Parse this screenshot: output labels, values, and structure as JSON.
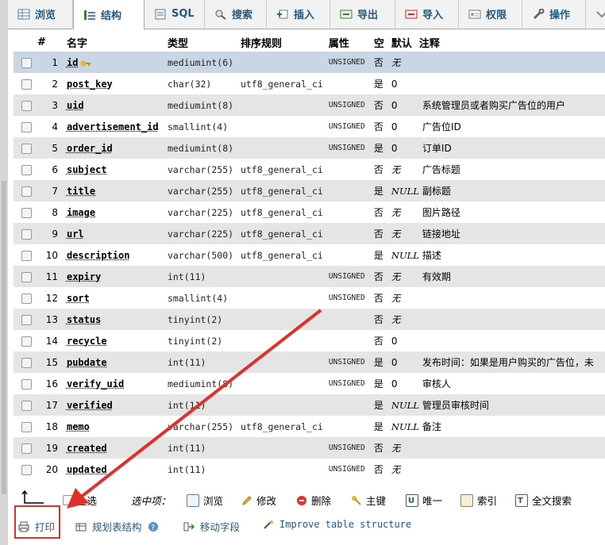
{
  "tabs": [
    {
      "label": "浏览",
      "icon": "browse-icon"
    },
    {
      "label": "结构",
      "icon": "structure-icon",
      "active": true
    },
    {
      "label": "SQL",
      "icon": "sql-icon"
    },
    {
      "label": "搜索",
      "icon": "search-icon"
    },
    {
      "label": "插入",
      "icon": "insert-icon"
    },
    {
      "label": "导出",
      "icon": "export-icon"
    },
    {
      "label": "导入",
      "icon": "import-icon"
    },
    {
      "label": "权限",
      "icon": "privileges-icon"
    },
    {
      "label": "操作",
      "icon": "operations-icon"
    }
  ],
  "table": {
    "headers": {
      "num": "#",
      "name": "名字",
      "type": "类型",
      "collation": "排序规则",
      "attributes": "属性",
      "null": "空",
      "default": "默认",
      "comment": "注释"
    },
    "rows": [
      {
        "num": "1",
        "name": "id",
        "type": "mediumint(6)",
        "collation": "",
        "attributes": "UNSIGNED",
        "null": "否",
        "default": "无",
        "comment": "",
        "primary": true
      },
      {
        "num": "2",
        "name": "post_key",
        "type": "char(32)",
        "collation": "utf8_general_ci",
        "attributes": "",
        "null": "是",
        "default": "0",
        "comment": ""
      },
      {
        "num": "3",
        "name": "uid",
        "type": "mediumint(8)",
        "collation": "",
        "attributes": "UNSIGNED",
        "null": "否",
        "default": "0",
        "comment": "系统管理员或者购买广告位的用户"
      },
      {
        "num": "4",
        "name": "advertisement_id",
        "type": "smallint(4)",
        "collation": "",
        "attributes": "UNSIGNED",
        "null": "否",
        "default": "0",
        "comment": "广告位ID"
      },
      {
        "num": "5",
        "name": "order_id",
        "type": "mediumint(8)",
        "collation": "",
        "attributes": "UNSIGNED",
        "null": "是",
        "default": "0",
        "comment": "订单ID"
      },
      {
        "num": "6",
        "name": "subject",
        "type": "varchar(255)",
        "collation": "utf8_general_ci",
        "attributes": "",
        "null": "否",
        "default": "无",
        "comment": "广告标题"
      },
      {
        "num": "7",
        "name": "title",
        "type": "varchar(255)",
        "collation": "utf8_general_ci",
        "attributes": "",
        "null": "是",
        "default": "NULL",
        "comment": "副标题"
      },
      {
        "num": "8",
        "name": "image",
        "type": "varchar(225)",
        "collation": "utf8_general_ci",
        "attributes": "",
        "null": "否",
        "default": "无",
        "comment": "图片路径"
      },
      {
        "num": "9",
        "name": "url",
        "type": "varchar(225)",
        "collation": "utf8_general_ci",
        "attributes": "",
        "null": "否",
        "default": "无",
        "comment": "链接地址"
      },
      {
        "num": "10",
        "name": "description",
        "type": "varchar(500)",
        "collation": "utf8_general_ci",
        "attributes": "",
        "null": "是",
        "default": "NULL",
        "comment": "描述"
      },
      {
        "num": "11",
        "name": "expiry",
        "type": "int(11)",
        "collation": "",
        "attributes": "UNSIGNED",
        "null": "否",
        "default": "无",
        "comment": "有效期"
      },
      {
        "num": "12",
        "name": "sort",
        "type": "smallint(4)",
        "collation": "",
        "attributes": "UNSIGNED",
        "null": "否",
        "default": "无",
        "comment": ""
      },
      {
        "num": "13",
        "name": "status",
        "type": "tinyint(2)",
        "collation": "",
        "attributes": "",
        "null": "否",
        "default": "无",
        "comment": ""
      },
      {
        "num": "14",
        "name": "recycle",
        "type": "tinyint(2)",
        "collation": "",
        "attributes": "",
        "null": "否",
        "default": "0",
        "comment": ""
      },
      {
        "num": "15",
        "name": "pubdate",
        "type": "int(11)",
        "collation": "",
        "attributes": "UNSIGNED",
        "null": "是",
        "default": "0",
        "comment": "发布时间：如果是用户购买的广告位，未"
      },
      {
        "num": "16",
        "name": "verify_uid",
        "type": "mediumint(8)",
        "collation": "",
        "attributes": "UNSIGNED",
        "null": "是",
        "default": "0",
        "comment": "审核人"
      },
      {
        "num": "17",
        "name": "verified",
        "type": "int(11)",
        "collation": "",
        "attributes": "",
        "null": "是",
        "default": "NULL",
        "comment": "管理员审核时间"
      },
      {
        "num": "18",
        "name": "memo",
        "type": "varchar(255)",
        "collation": "utf8_general_ci",
        "attributes": "",
        "null": "是",
        "default": "NULL",
        "comment": "备注"
      },
      {
        "num": "19",
        "name": "created",
        "type": "int(11)",
        "collation": "",
        "attributes": "UNSIGNED",
        "null": "否",
        "default": "无",
        "comment": ""
      },
      {
        "num": "20",
        "name": "updated",
        "type": "int(11)",
        "collation": "",
        "attributes": "UNSIGNED",
        "null": "否",
        "default": "无",
        "comment": ""
      }
    ]
  },
  "bulk": {
    "check_all": "全选",
    "with_selected": "选中项：",
    "actions": [
      {
        "label": "浏览",
        "icon": "browse-icon"
      },
      {
        "label": "修改",
        "icon": "pencil-icon"
      },
      {
        "label": "删除",
        "icon": "delete-icon"
      },
      {
        "label": "主键",
        "icon": "key-icon"
      },
      {
        "label": "唯一",
        "icon": "unique-icon"
      },
      {
        "label": "索引",
        "icon": "index-icon"
      },
      {
        "label": "全文搜索",
        "icon": "fulltext-icon"
      }
    ]
  },
  "bottom": {
    "print": "打印",
    "propose": "规划表结构",
    "move": "移动字段",
    "improve": "Improve table structure"
  },
  "colors": {
    "highlight": "#c9d6e3",
    "even_row": "#e5e5e5",
    "annotation": "#e0302b",
    "link": "#235a81"
  }
}
